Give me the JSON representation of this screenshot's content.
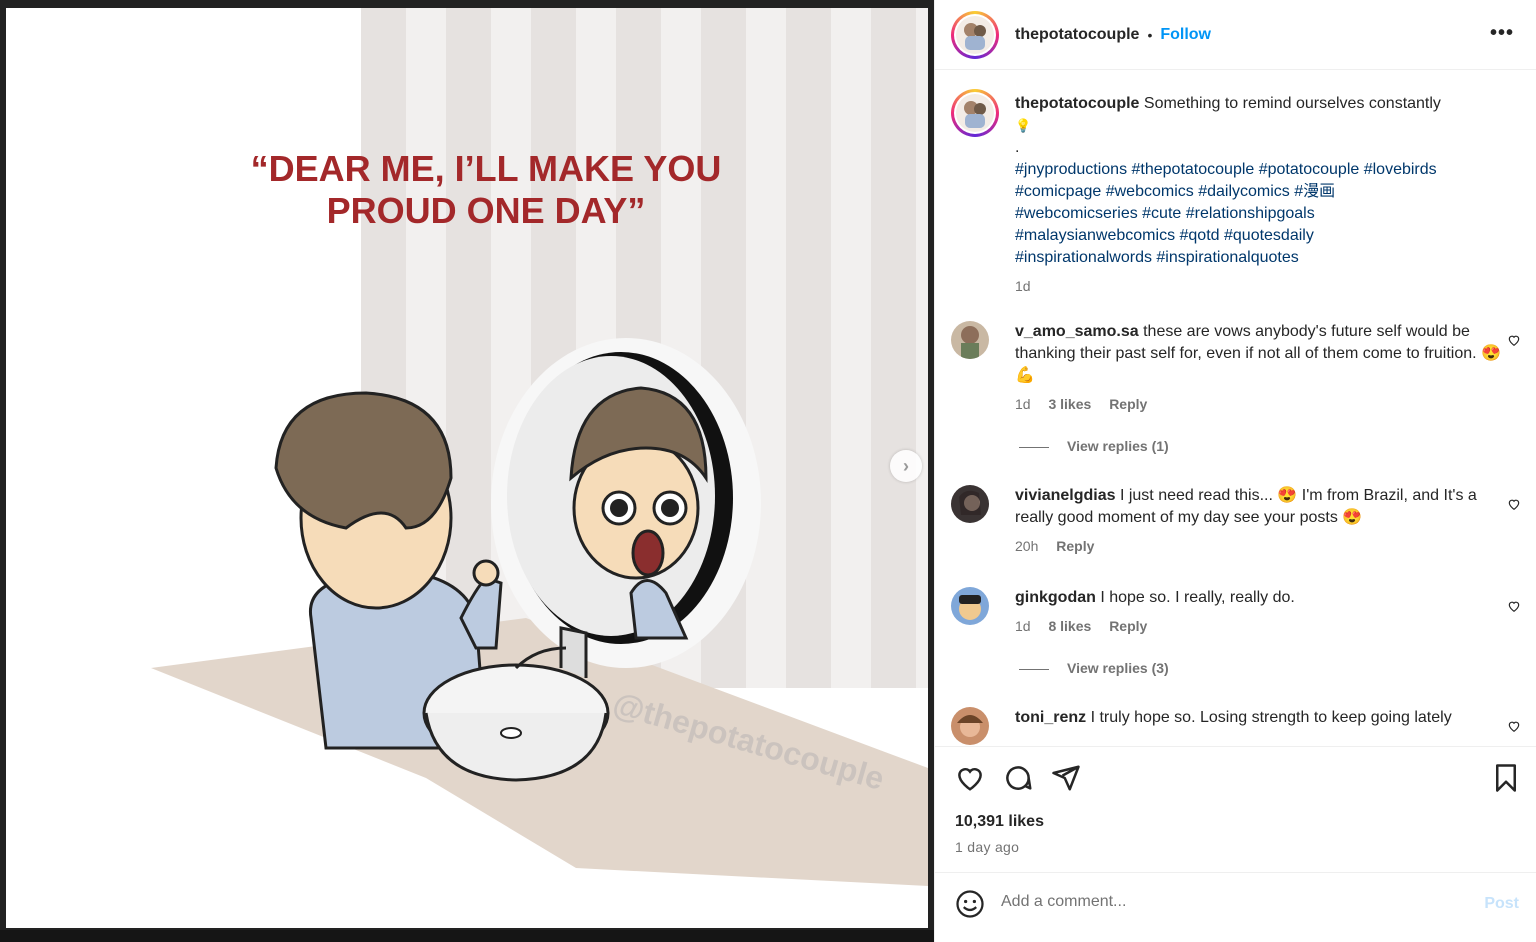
{
  "post": {
    "username": "thepotatocouple",
    "follow_label": "Follow",
    "separator": "•",
    "more_label": "•••",
    "image": {
      "quote_line1": "“DEAR ME, I’LL MAKE YOU",
      "quote_line2": "PROUD ONE DAY”",
      "watermark": "@thepotatocouple"
    },
    "next_label": "›"
  },
  "caption": {
    "username": "thepotatocouple",
    "text": "Something to remind ourselves constantly",
    "emoji": "💡",
    "dot_line": ".",
    "hashtag_lines": [
      "#jnyproductions #thepotatocouple #potatocouple #lovebirds",
      "#comicpage #webcomics #dailycomics #漫画",
      "#webcomicseries #cute #relationshipgoals",
      "#malaysianwebcomics #qotd #quotesdaily",
      "#inspirationalwords #inspirationalquotes"
    ],
    "time": "1d"
  },
  "comments": [
    {
      "username": "v_amo_samo.sa",
      "text": "these are vows anybody's future self would be thanking their past self for, even if not all of them come to fruition. 😍💪",
      "time": "1d",
      "likes": "3 likes",
      "reply": "Reply",
      "view_replies": "View replies (1)"
    },
    {
      "username": "vivianelgdias",
      "text": "I just need read this... 😍 I'm from Brazil, and It's a really good moment of my day see your posts 😍",
      "time": "20h",
      "reply": "Reply"
    },
    {
      "username": "ginkgodan",
      "text": "I hope so. I really, really do.",
      "time": "1d",
      "likes": "8 likes",
      "reply": "Reply",
      "view_replies": "View replies (3)"
    },
    {
      "username": "toni_renz",
      "text": "I truly hope so. Losing strength to keep going lately"
    }
  ],
  "actions": {
    "likes": "10,391 likes",
    "time_ago": "1 day ago"
  },
  "comment_box": {
    "placeholder": "Add a comment...",
    "post_label": "Post"
  },
  "colors": {
    "link_blue": "#0095f6",
    "hashtag": "#00376b",
    "quote_red": "#a3282a",
    "muted": "#737373"
  }
}
